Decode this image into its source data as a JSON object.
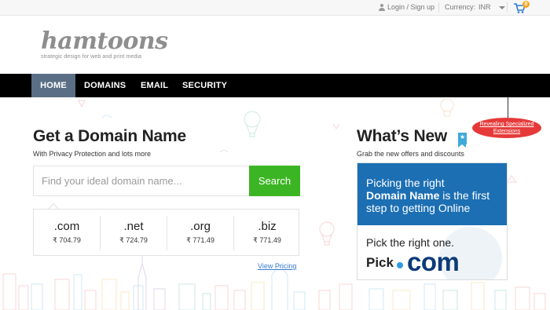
{
  "topbar": {
    "login_label": "Login / Sign up",
    "currency_label": "Currency:",
    "currency_value": "INR",
    "cart_count": "0"
  },
  "logo": {
    "brand": "hamtoons",
    "tagline": "strategic design for web and print media"
  },
  "nav": {
    "items": [
      {
        "label": "HOME",
        "active": true
      },
      {
        "label": "DOMAINS"
      },
      {
        "label": "EMAIL"
      },
      {
        "label": "SECURITY"
      }
    ]
  },
  "domain": {
    "title": "Get a Domain Name",
    "subtitle": "With Privacy Protection and lots more",
    "search_placeholder": "Find your ideal domain name...",
    "search_value": "",
    "search_button": "Search",
    "tlds": [
      {
        "name": ".com",
        "price": "₹ 704.79"
      },
      {
        "name": ".net",
        "price": "₹ 724.79"
      },
      {
        "name": ".org",
        "price": "₹ 771.49"
      },
      {
        "name": ".biz",
        "price": "₹ 771.49"
      }
    ],
    "view_pricing": "View Pricing"
  },
  "whats_new": {
    "title": "What’s New",
    "subtitle": "Grab the new offers and discounts",
    "tag_line1": "Revealing Specialized",
    "tag_line2": "Extensions",
    "promo": {
      "line1": "Picking the right",
      "line2_bold": "Domain Name",
      "line2_rest": " is the first",
      "line3": "step to getting Online",
      "pick_one": "Pick the right one.",
      "pick": "Pick",
      "com": "com"
    }
  },
  "colors": {
    "nav_bg": "#000000",
    "nav_active": "#5a6f85",
    "search_button": "#3cb524",
    "promo_blue": "#1c6fb3",
    "tag_red": "#e63a3a",
    "com_navy": "#0d3b78",
    "link_blue": "#3a7bd5"
  },
  "icons": [
    "user-icon",
    "chevron-down-icon",
    "cart-icon",
    "bookmark-star-icon"
  ]
}
